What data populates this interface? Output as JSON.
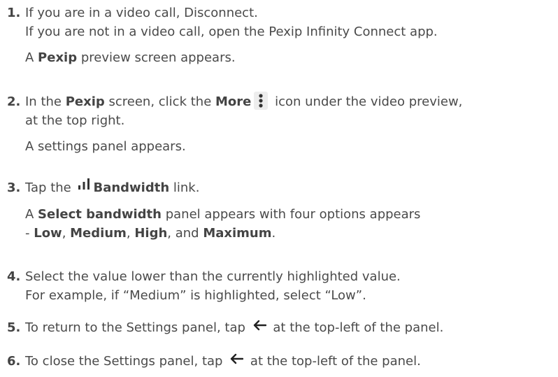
{
  "steps": [
    {
      "number": "1.",
      "line1": "If you are in a video call, Disconnect.",
      "line2": "If you are not in a video call, open the Pexip Infinity Connect app.",
      "result_pre": "A ",
      "result_bold": "Pexip",
      "result_post": " preview screen appears."
    },
    {
      "number": "2.",
      "pre": "In the ",
      "bold1": "Pexip",
      "mid": " screen, click the ",
      "bold2": "More",
      "post": " icon under the video preview,",
      "line2": "at the top right.",
      "result": "A settings panel appears."
    },
    {
      "number": "3.",
      "pre": "Tap the ",
      "bold": "Bandwidth",
      "post": " link.",
      "result_pre": "A ",
      "result_bold": "Select bandwidth",
      "result_post": " panel appears with four options appears",
      "result2_pre": "- ",
      "options": [
        "Low",
        "Medium",
        "High",
        "Maximum"
      ],
      "sep1": ", ",
      "sep2": ", ",
      "sep3": ", and ",
      "end": "."
    },
    {
      "number": "4.",
      "line1": "Select the value lower than the currently highlighted value.",
      "line2": "For example, if “Medium” is highlighted, select “Low”."
    },
    {
      "number": "5.",
      "pre": "To return to the Settings panel, tap ",
      "post": " at the top-left of the panel."
    },
    {
      "number": "6.",
      "pre": "To close the Settings panel, tap ",
      "post": " at the top-left of the panel."
    }
  ],
  "icons": {
    "more": "more-vertical-icon",
    "bandwidth": "signal-bars-icon",
    "back": "arrow-left-icon"
  }
}
